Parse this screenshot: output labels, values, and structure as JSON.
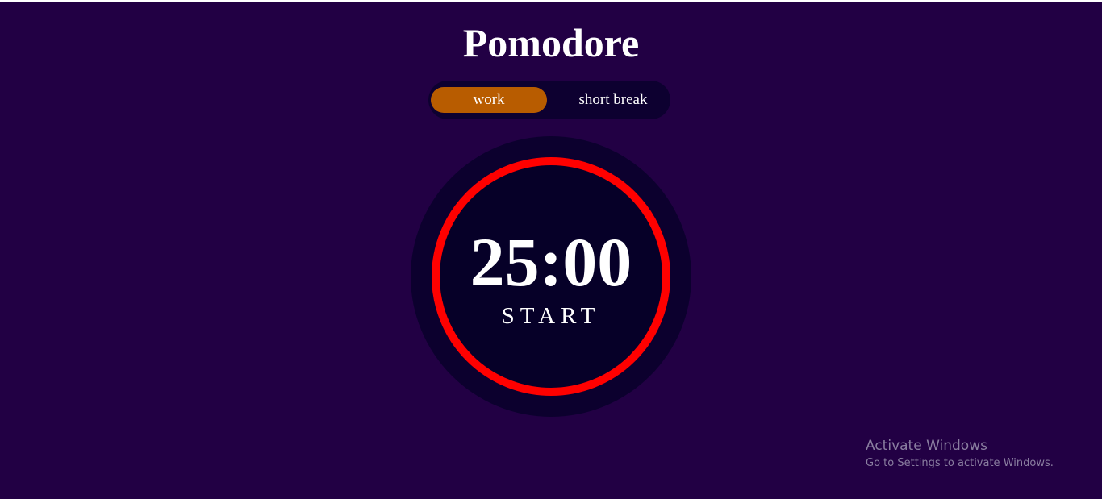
{
  "app": {
    "title": "Pomodore"
  },
  "modes": {
    "work_label": "work",
    "short_break_label": "short break",
    "active": "work"
  },
  "timer": {
    "time": "25:00",
    "start_label": "START",
    "progress": 1.0
  },
  "watermark": {
    "title": "Activate Windows",
    "subtitle": "Go to Settings to activate Windows."
  },
  "colors": {
    "background": "#220044",
    "panel": "#0c002e",
    "accent": "#b85c00",
    "ring": "#ff0000",
    "text": "#ffffff"
  }
}
